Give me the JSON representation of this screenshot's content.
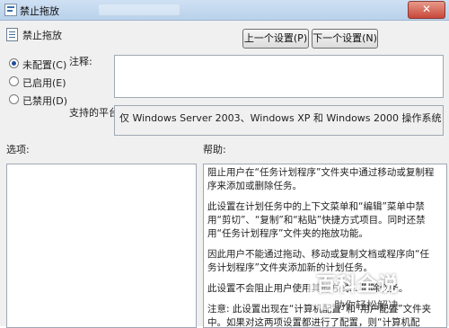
{
  "window": {
    "title": "禁止拖放",
    "close_glyph": "✕"
  },
  "policy": {
    "name": "禁止拖放"
  },
  "nav": {
    "prev_label": "上一个设置(P)",
    "next_label": "下一个设置(N)"
  },
  "state_options": [
    {
      "label": "未配置(C)",
      "selected": true
    },
    {
      "label": "已启用(E)",
      "selected": false
    },
    {
      "label": "已禁用(D)",
      "selected": false
    }
  ],
  "comment": {
    "label": "注释:",
    "value": ""
  },
  "platform": {
    "label": "支持的平台:",
    "value": "仅 Windows Server 2003、Windows XP 和 Windows 2000 操作系统"
  },
  "options": {
    "label": "选项:"
  },
  "help": {
    "label": "帮助:",
    "paragraphs": [
      "阻止用户在“任务计划程序”文件夹中通过移动或复制程序来添加或删除任务。",
      "此设置在计划任务中的上下文菜单和“编辑”菜单中禁用“剪切”、“复制”和“粘贴”快捷方式项目。同时还禁用“任务计划程序”文件夹的拖放功能。",
      "因此用户不能通过拖动、移动或复制文档或程序向“任务计划程序”文件夹添加新的计划任务。",
      "此设置不会阻止用户使用其他方式... 删除任务。",
      "注意: 此设置出现在“计算机配置”和“用户配置”文件夹中。如果对这两项设置都进行了配置，则“计算机配置”中的设置优先于"
    ]
  },
  "watermark": {
    "title": "百科全说",
    "subtitle": "助你轻松解决"
  }
}
